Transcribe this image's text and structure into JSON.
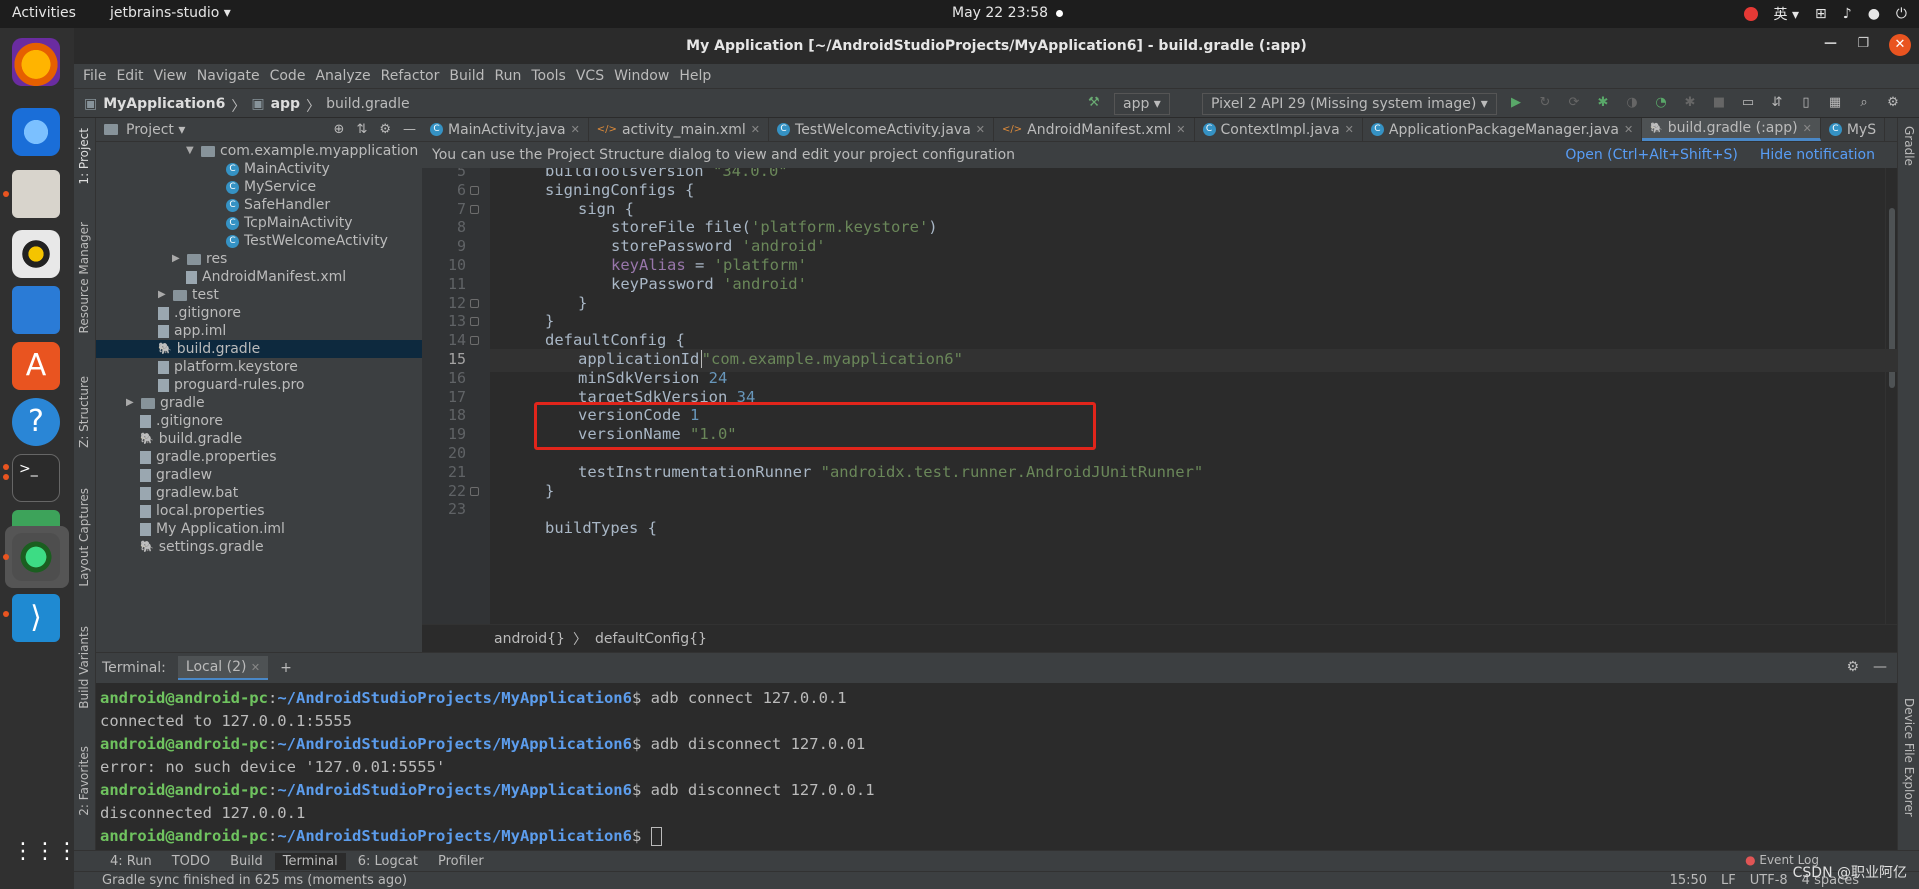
{
  "topbar": {
    "activities": "Activities",
    "app": "jetbrains-studio ▾",
    "clock": "May 22  23:58",
    "lang": "英 ▾"
  },
  "window": {
    "title": "My Application [~/AndroidStudioProjects/MyApplication6] - build.gradle (:app)"
  },
  "menu": [
    "File",
    "Edit",
    "View",
    "Navigate",
    "Code",
    "Analyze",
    "Refactor",
    "Build",
    "Run",
    "Tools",
    "VCS",
    "Window",
    "Help"
  ],
  "nav": {
    "project": "MyApplication6",
    "module": "app",
    "file": "build.gradle",
    "run_config": "app ▾",
    "device": "Pixel 2 API 29 (Missing system image) ▾"
  },
  "left_strip": [
    "1: Project",
    "Resource Manager",
    "Z: Structure",
    "Layout Captures",
    "Build Variants",
    "2: Favorites"
  ],
  "right_strip": [
    "Gradle",
    "Device File Explorer"
  ],
  "project_panel": {
    "title": "Project ▾",
    "rows": [
      {
        "label": "com.example.myapplication",
        "indent": 90,
        "kind": "pkg",
        "arrow": "▼"
      },
      {
        "label": "MainActivity",
        "indent": 130,
        "kind": "class"
      },
      {
        "label": "MyService",
        "indent": 130,
        "kind": "class"
      },
      {
        "label": "SafeHandler",
        "indent": 130,
        "kind": "class"
      },
      {
        "label": "TcpMainActivity",
        "indent": 130,
        "kind": "class"
      },
      {
        "label": "TestWelcomeActivity",
        "indent": 130,
        "kind": "class"
      },
      {
        "label": "res",
        "indent": 76,
        "kind": "folder",
        "arrow": "▶"
      },
      {
        "label": "AndroidManifest.xml",
        "indent": 90,
        "kind": "file"
      },
      {
        "label": "test",
        "indent": 62,
        "kind": "folder",
        "arrow": "▶"
      },
      {
        "label": ".gitignore",
        "indent": 62,
        "kind": "file"
      },
      {
        "label": "app.iml",
        "indent": 62,
        "kind": "file"
      },
      {
        "label": "build.gradle",
        "indent": 62,
        "kind": "gradle",
        "selected": true
      },
      {
        "label": "platform.keystore",
        "indent": 62,
        "kind": "file"
      },
      {
        "label": "proguard-rules.pro",
        "indent": 62,
        "kind": "file"
      },
      {
        "label": "gradle",
        "indent": 30,
        "kind": "folder",
        "arrow": "▶"
      },
      {
        "label": ".gitignore",
        "indent": 44,
        "kind": "file"
      },
      {
        "label": "build.gradle",
        "indent": 44,
        "kind": "gradle"
      },
      {
        "label": "gradle.properties",
        "indent": 44,
        "kind": "file"
      },
      {
        "label": "gradlew",
        "indent": 44,
        "kind": "file"
      },
      {
        "label": "gradlew.bat",
        "indent": 44,
        "kind": "file"
      },
      {
        "label": "local.properties",
        "indent": 44,
        "kind": "file"
      },
      {
        "label": "My Application.iml",
        "indent": 44,
        "kind": "file"
      },
      {
        "label": "settings.gradle",
        "indent": 44,
        "kind": "gradle"
      }
    ]
  },
  "tabs": [
    {
      "label": "MainActivity.java"
    },
    {
      "label": "activity_main.xml"
    },
    {
      "label": "TestWelcomeActivity.java"
    },
    {
      "label": "AndroidManifest.xml"
    },
    {
      "label": "ContextImpl.java"
    },
    {
      "label": "ApplicationPackageManager.java"
    },
    {
      "label": "build.gradle (:app)",
      "active": true
    },
    {
      "label": "MyS"
    }
  ],
  "notification": {
    "text": "You can use the Project Structure dialog to view and edit your project configuration",
    "open": "Open (Ctrl+Alt+Shift+S)",
    "hide": "Hide notification"
  },
  "code_lines": [
    {
      "n": "5",
      "ind": 2,
      "parts": [
        [
          "buildToolsVersion ",
          ""
        ],
        [
          "\"34.0.0\"",
          "s"
        ]
      ]
    },
    {
      "n": "6",
      "ind": 2,
      "parts": [
        [
          "signingConfigs {",
          ""
        ]
      ],
      "fold": true
    },
    {
      "n": "7",
      "ind": 4,
      "parts": [
        [
          "sign {",
          ""
        ]
      ],
      "fold": true
    },
    {
      "n": "8",
      "ind": 6,
      "parts": [
        [
          "storeFile file(",
          ""
        ],
        [
          "'platform.keystore'",
          "s"
        ],
        [
          ")",
          ""
        ]
      ]
    },
    {
      "n": "9",
      "ind": 6,
      "parts": [
        [
          "storePassword ",
          ""
        ],
        [
          "'android'",
          "s"
        ]
      ]
    },
    {
      "n": "10",
      "ind": 6,
      "parts": [
        [
          "keyAlias",
          "p"
        ],
        [
          " = ",
          ""
        ],
        [
          "'platform'",
          "s"
        ]
      ]
    },
    {
      "n": "11",
      "ind": 6,
      "parts": [
        [
          "keyPassword ",
          ""
        ],
        [
          "'android'",
          "s"
        ]
      ]
    },
    {
      "n": "12",
      "ind": 4,
      "parts": [
        [
          "}",
          ""
        ]
      ],
      "fold": true
    },
    {
      "n": "13",
      "ind": 2,
      "parts": [
        [
          "}",
          ""
        ]
      ],
      "fold": true
    },
    {
      "n": "14",
      "ind": 2,
      "parts": [
        [
          "defaultConfig {",
          ""
        ]
      ],
      "fold": true
    },
    {
      "n": "15",
      "ind": 4,
      "parts": [
        [
          "applicationId ",
          ""
        ],
        [
          "\"com.example.myapplication6\"",
          "s"
        ]
      ],
      "current": true
    },
    {
      "n": "16",
      "ind": 4,
      "parts": [
        [
          "minSdkVersion ",
          ""
        ],
        [
          "24",
          "n"
        ]
      ]
    },
    {
      "n": "17",
      "ind": 4,
      "parts": [
        [
          "targetSdkVersion ",
          ""
        ],
        [
          "34",
          "n"
        ]
      ]
    },
    {
      "n": "18",
      "ind": 4,
      "parts": [
        [
          "versionCode ",
          ""
        ],
        [
          "1",
          "n"
        ]
      ]
    },
    {
      "n": "19",
      "ind": 4,
      "parts": [
        [
          "versionName ",
          ""
        ],
        [
          "\"1.0\"",
          "s"
        ]
      ]
    },
    {
      "n": "20",
      "ind": 4,
      "parts": [
        [
          "",
          ""
        ]
      ]
    },
    {
      "n": "21",
      "ind": 4,
      "parts": [
        [
          "testInstrumentationRunner ",
          ""
        ],
        [
          "\"androidx.test.runner.AndroidJUnitRunner\"",
          "s"
        ]
      ]
    },
    {
      "n": "22",
      "ind": 2,
      "parts": [
        [
          "}",
          ""
        ]
      ],
      "fold": true
    },
    {
      "n": "23",
      "ind": 2,
      "parts": [
        [
          "",
          ""
        ]
      ]
    },
    {
      "n": "",
      "ind": 2,
      "parts": [
        [
          "buildTypes {",
          ""
        ]
      ]
    }
  ],
  "breadcrumb": [
    "android{}",
    "defaultConfig{}"
  ],
  "terminal": {
    "label": "Terminal:",
    "tab": "Local (2)",
    "prompt_user": "android@android-pc",
    "prompt_path": "~/AndroidStudioProjects/MyApplication6",
    "lines": [
      {
        "type": "cmd",
        "cmd": "adb connect 127.0.0.1"
      },
      {
        "type": "out",
        "text": "connected to 127.0.0.1:5555"
      },
      {
        "type": "cmd",
        "cmd": "adb disconnect 127.0.01"
      },
      {
        "type": "out",
        "text": "error: no such device '127.0.01:5555'"
      },
      {
        "type": "cmd",
        "cmd": "adb disconnect 127.0.0.1"
      },
      {
        "type": "out",
        "text": "disconnected 127.0.0.1"
      },
      {
        "type": "cmd",
        "cmd": ""
      }
    ]
  },
  "bottom_tabs": [
    {
      "label": "4: Run"
    },
    {
      "label": "TODO"
    },
    {
      "label": "Build"
    },
    {
      "label": "Terminal",
      "on": true
    },
    {
      "label": "6: Logcat"
    },
    {
      "label": "Profiler"
    }
  ],
  "event_log": "Event Log",
  "status": {
    "msg": "Gradle sync finished in 625 ms (moments ago)",
    "pos": "15:50",
    "lf": "LF",
    "enc": "UTF-8",
    "indent": "4 spaces"
  },
  "watermark": "CSDN @职业阿亿",
  "colors": {
    "string": "#6a8759",
    "number": "#6897bb",
    "keyword": "#cc7832",
    "property": "#9876aa",
    "highlight_box": "#e1251b"
  }
}
